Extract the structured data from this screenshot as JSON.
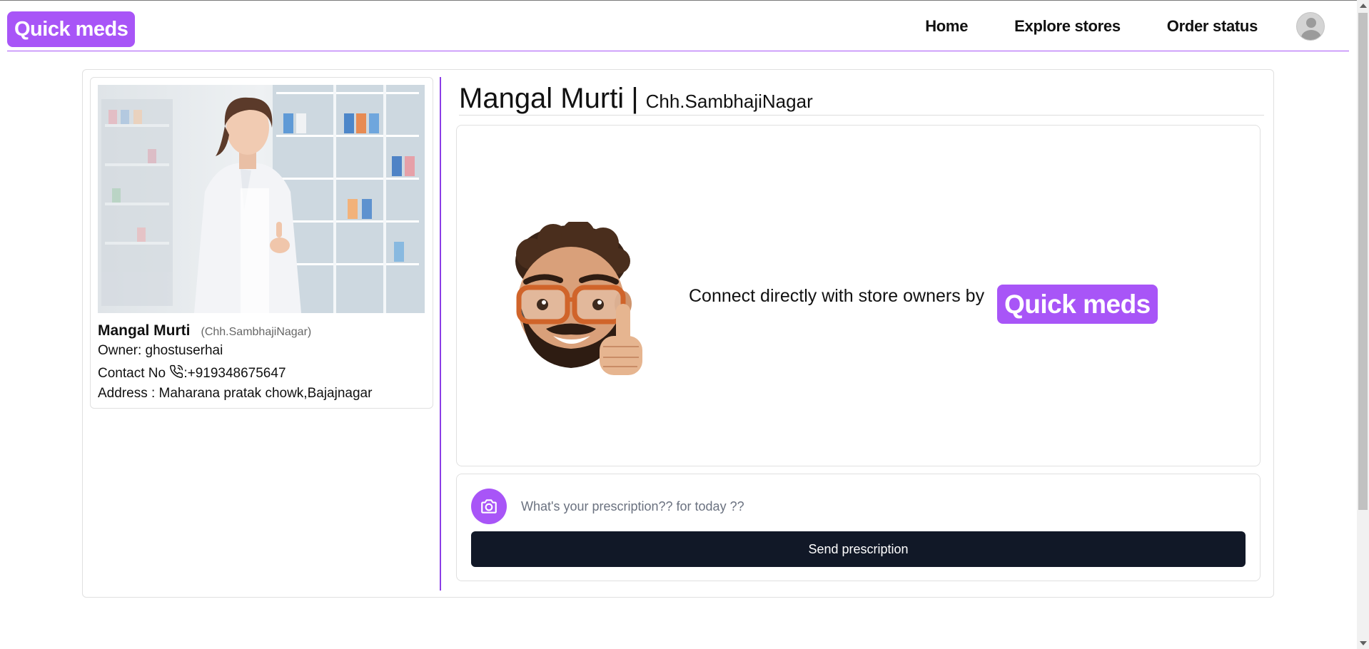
{
  "navbar": {
    "logo": "Quick meds",
    "links": [
      "Home",
      "Explore stores",
      "Order status"
    ],
    "avatar_icon": "user-avatar-icon"
  },
  "store_card": {
    "name": "Mangal Murti",
    "city": "(Chh.SambhajiNagar)",
    "owner": "Owner: ghostuserhai",
    "contact_label": "Contact No",
    "contact_value": ":+919348675647",
    "address": "Address : Maharana pratak chowk,Bajajnagar",
    "phone_icon": "phone-icon"
  },
  "header": {
    "store_name": "Mangal Murti",
    "separator": "|",
    "city": "Chh.SambhajiNagar"
  },
  "promo": {
    "text": "Connect directly with store owners by",
    "logo": "Quick meds"
  },
  "prescription": {
    "camera_icon": "camera-icon",
    "placeholder": "What's your prescription?? for today ??",
    "value": "",
    "send_label": "Send prescription"
  },
  "colors": {
    "brand": "#a855f7",
    "button": "#111827",
    "divider": "#8b3ee6"
  }
}
